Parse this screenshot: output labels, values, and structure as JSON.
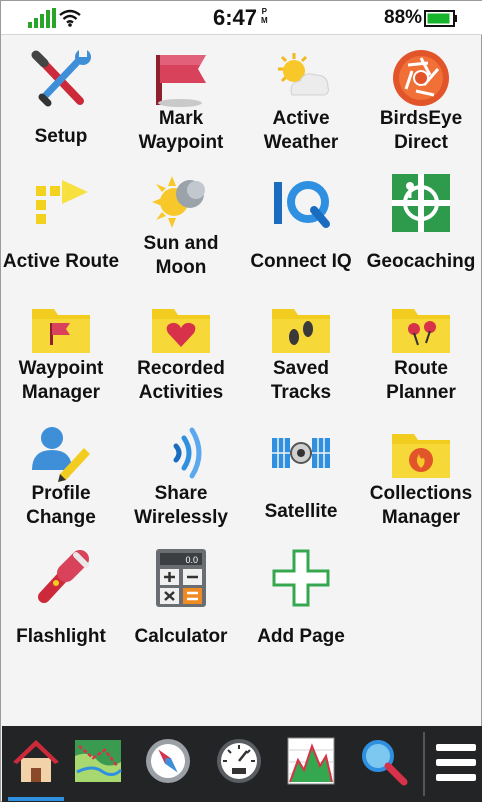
{
  "status": {
    "time": "6:47",
    "ampm_top": "P",
    "ampm_bottom": "M",
    "battery": "88%"
  },
  "apps": [
    {
      "name": "setup",
      "label": "Setup"
    },
    {
      "name": "mark-waypoint",
      "label": "Mark\nWaypoint"
    },
    {
      "name": "active-weather",
      "label": "Active\nWeather"
    },
    {
      "name": "birdseye-direct",
      "label": "BirdsEye\nDirect"
    },
    {
      "name": "active-route",
      "label": "Active Route"
    },
    {
      "name": "sun-and-moon",
      "label": "Sun and\nMoon"
    },
    {
      "name": "connect-iq",
      "label": "Connect IQ"
    },
    {
      "name": "geocaching",
      "label": "Geocaching"
    },
    {
      "name": "waypoint-manager",
      "label": "Waypoint\nManager"
    },
    {
      "name": "recorded-activities",
      "label": "Recorded\nActivities"
    },
    {
      "name": "saved-tracks",
      "label": "Saved\nTracks"
    },
    {
      "name": "route-planner",
      "label": "Route\nPlanner"
    },
    {
      "name": "profile-change",
      "label": "Profile\nChange"
    },
    {
      "name": "share-wirelessly",
      "label": "Share\nWirelessly"
    },
    {
      "name": "satellite",
      "label": "Satellite"
    },
    {
      "name": "collections-manager",
      "label": "Collections\nManager"
    },
    {
      "name": "flashlight",
      "label": "Flashlight"
    },
    {
      "name": "calculator",
      "label": "Calculator",
      "display": "0.0"
    },
    {
      "name": "add-page",
      "label": "Add Page"
    }
  ],
  "dock": {
    "items": [
      "home-icon",
      "map-icon",
      "compass-icon",
      "trip-computer-icon",
      "elevation-plot-icon",
      "search-icon",
      "menu-icon"
    ]
  },
  "colors": {
    "folder_yellow": "#f2cd1f",
    "accent_blue": "#2f8fe0",
    "dock_bg": "#222426",
    "battery_green": "#17b52b"
  }
}
